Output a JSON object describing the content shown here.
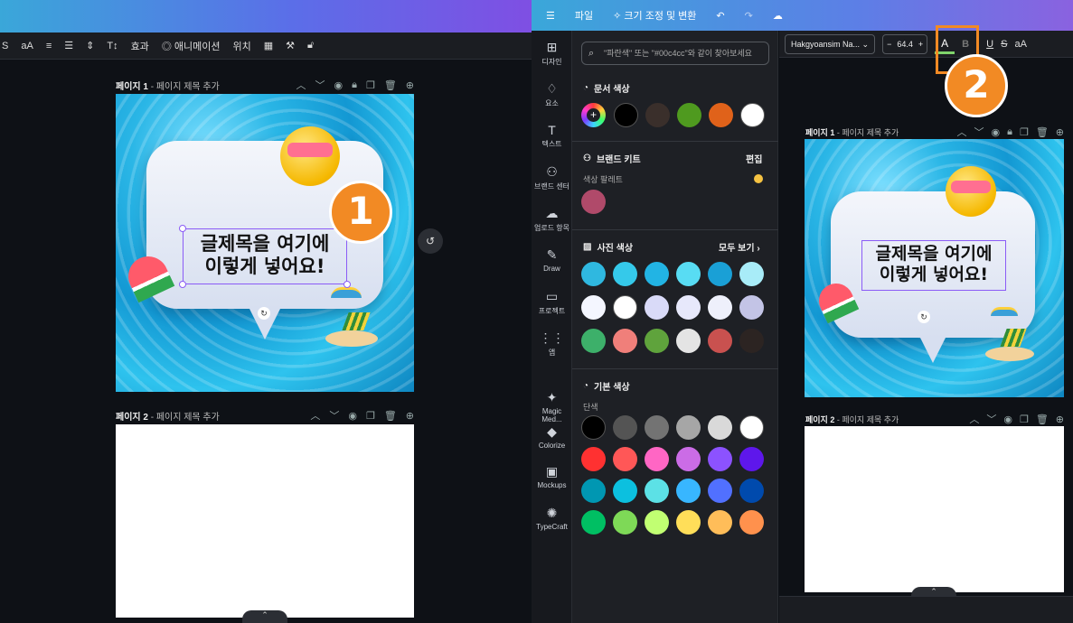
{
  "left": {
    "toolbar": {
      "strike": "S",
      "case": "aA",
      "effects": "효과",
      "animate": "애니메이션",
      "position": "위치"
    },
    "page1": {
      "number": "페이지 1",
      "title": "페이지 제목 추가"
    },
    "page2": {
      "number": "페이지 2",
      "title": "페이지 제목 추가"
    },
    "headline_line1": "글제목을 여기에",
    "headline_line2": "이렇게 넣어요!",
    "badge": "1"
  },
  "right": {
    "topbar": {
      "menu": "☰",
      "file": "파일",
      "resize": "✧ 크기 조정 및 변환"
    },
    "rail": [
      {
        "icon": "⊞",
        "label": "디자인"
      },
      {
        "icon": "♢",
        "label": "요소"
      },
      {
        "icon": "T",
        "label": "텍스트"
      },
      {
        "icon": "⚇",
        "label": "브랜드 센터"
      },
      {
        "icon": "☁",
        "label": "업로드 항목"
      },
      {
        "icon": "✎",
        "label": "Draw"
      },
      {
        "icon": "▭",
        "label": "프로젝트"
      },
      {
        "icon": "⋮⋮",
        "label": "앱"
      },
      {
        "icon": "✦",
        "label": "Magic Med..."
      },
      {
        "icon": "◆",
        "label": "Colorize"
      },
      {
        "icon": "▣",
        "label": "Mockups"
      },
      {
        "icon": "✺",
        "label": "TypeCraft"
      }
    ],
    "panel": {
      "search_placeholder": "\"파란색\" 또는 \"#00c4cc\"와 같이 찾아보세요",
      "doc_colors": "문서 색상",
      "brand_kit": "브랜드 키트",
      "edit": "편집",
      "palette": "색상 팔레트",
      "photo_colors": "사진 색상",
      "see_all": "모두 보기",
      "default_colors": "기본 색상",
      "solid": "단색"
    },
    "font": {
      "name": "Hakgyoansim Na...",
      "size": "64.4",
      "minus": "−",
      "plus": "+"
    },
    "page1": {
      "number": "페이지 1",
      "title": "페이지 제목 추가"
    },
    "page2": {
      "number": "페이지 2",
      "title": "페이지 제목 추가"
    },
    "headline_line1": "글제목을 여기에",
    "headline_line2": "이렇게 넣어요!",
    "badge": "2"
  },
  "colors": {
    "doc": [
      "#000000",
      "#3a2f2b",
      "#4f9a1f",
      "#e0621a",
      "#ffffff"
    ],
    "brand": [
      "#b04a6a"
    ],
    "photo": [
      "#2fb8e0",
      "#35c9ea",
      "#22b4e4",
      "#58dcf3",
      "#1aa0d6",
      "#a8ecf8",
      "#f4f6ff",
      "#ffffff",
      "#d9daf8",
      "#e7e8fb",
      "#eef0fb",
      "#c3c4e6",
      "#3db06a",
      "#f07f7a",
      "#5fa33c",
      "#e4e4e4",
      "#c9514f",
      "#2c2422"
    ],
    "default": [
      "#000000",
      "#545454",
      "#737373",
      "#a6a6a6",
      "#d9d9d9",
      "#ffffff",
      "#ff3131",
      "#ff5757",
      "#ff66c4",
      "#cb6ce6",
      "#8c52ff",
      "#5e17eb",
      "#0097b2",
      "#0cc0df",
      "#5ce1e6",
      "#38b6ff",
      "#5170ff",
      "#004aad",
      "#00bf63",
      "#7ed957",
      "#c1ff72",
      "#ffde59",
      "#ffbd59",
      "#ff914d"
    ]
  }
}
